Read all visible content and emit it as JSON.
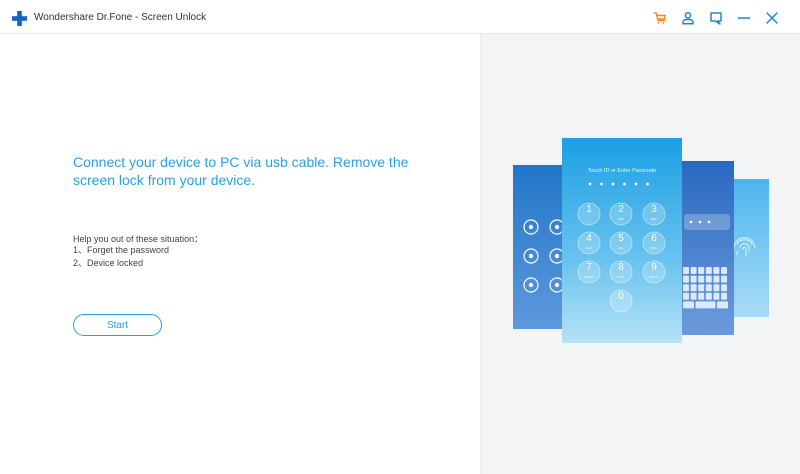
{
  "window": {
    "title": "Wondershare Dr.Fone - Screen Unlock"
  },
  "toolbar": {
    "icons": [
      "cart-icon",
      "user-icon",
      "feedback-icon",
      "minimize-icon",
      "close-icon"
    ]
  },
  "main": {
    "headline": "Connect your device to PC via usb cable. Remove the screen lock from your device.",
    "help_intro": "Help you out of these situation：",
    "help_items": [
      "1、Forget the password",
      "2、Device locked"
    ],
    "start_label": "Start"
  },
  "illustration": {
    "passcode_prompt": "Touch ID or Enter Passcode",
    "keypad": [
      {
        "digit": "1",
        "letters": ""
      },
      {
        "digit": "2",
        "letters": "ABC"
      },
      {
        "digit": "3",
        "letters": "DEF"
      },
      {
        "digit": "4",
        "letters": "GHI"
      },
      {
        "digit": "5",
        "letters": "JKL"
      },
      {
        "digit": "6",
        "letters": "MNO"
      },
      {
        "digit": "7",
        "letters": "PQRS"
      },
      {
        "digit": "8",
        "letters": "TUV"
      },
      {
        "digit": "9",
        "letters": "WXYZ"
      },
      {
        "digit": "0",
        "letters": ""
      }
    ]
  },
  "colors": {
    "accent": "#2aa0e0",
    "logo_blue": "#1565c0",
    "cart_orange": "#ef8a1c",
    "icon_blue": "#1e88c8"
  }
}
